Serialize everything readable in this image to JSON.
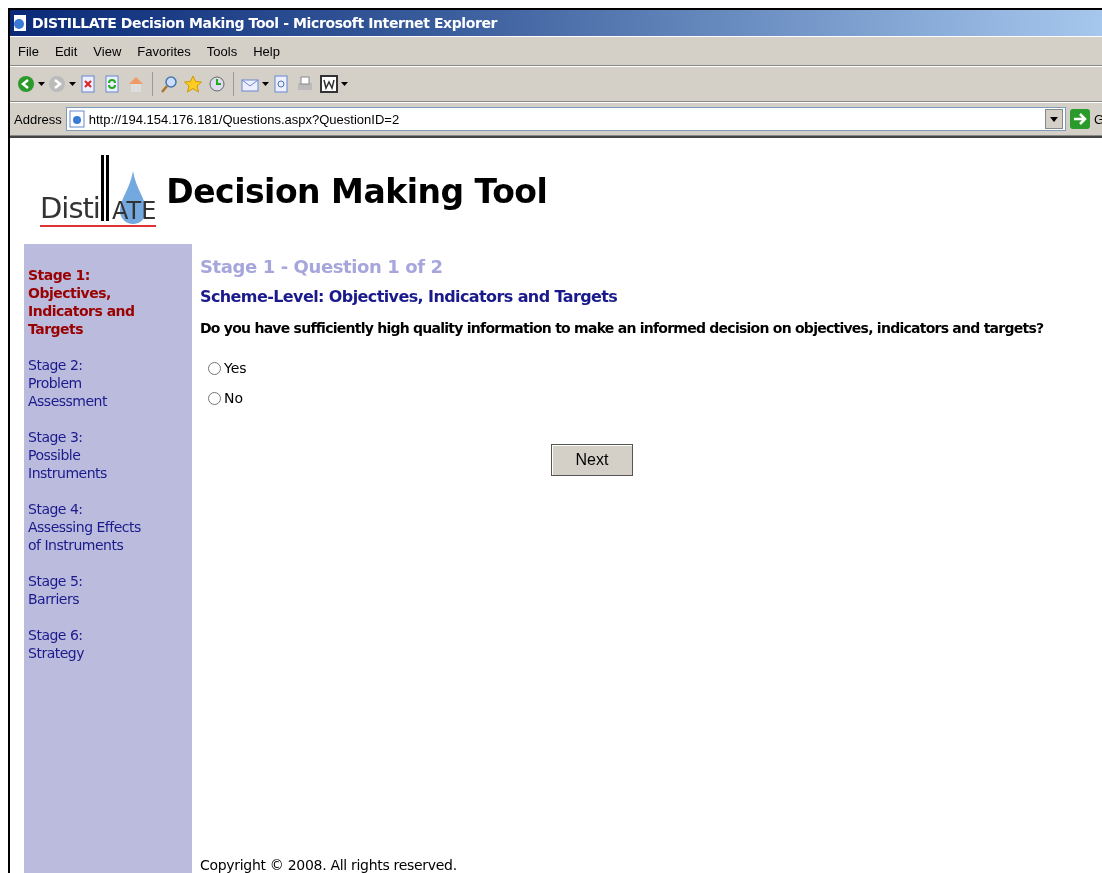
{
  "window": {
    "title": "DISTILLATE Decision Making Tool - Microsoft Internet Explorer"
  },
  "menu": [
    "File",
    "Edit",
    "View",
    "Favorites",
    "Tools",
    "Help"
  ],
  "address": {
    "label": "Address",
    "value": "http://194.154.176.181/Questions.aspx?QuestionID=2",
    "go": "G"
  },
  "header": {
    "logo": {
      "left": "Disti",
      "right": "ATE"
    },
    "title": "Decision Making Tool"
  },
  "sidebar": {
    "items": [
      {
        "stage": "Stage 1:",
        "name": "Objectives, Indicators and Targets",
        "selected": true
      },
      {
        "stage": "Stage 2:",
        "name": "Problem Assessment",
        "selected": false
      },
      {
        "stage": "Stage 3:",
        "name": "Possible Instruments",
        "selected": false
      },
      {
        "stage": "Stage 4:",
        "name": "Assessing Effects of Instruments",
        "selected": false
      },
      {
        "stage": "Stage 5:",
        "name": "Barriers",
        "selected": false
      },
      {
        "stage": "Stage 6:",
        "name": "Strategy",
        "selected": false
      }
    ]
  },
  "main": {
    "progress": "Stage 1 - Question 1 of 2",
    "section": "Scheme-Level: Objectives, Indicators and Targets",
    "question": "Do you have sufficiently high quality information to make an informed decision on objectives, indicators and targets?",
    "options": [
      {
        "label": "Yes",
        "checked": false
      },
      {
        "label": "No",
        "checked": false
      }
    ],
    "button": "Next",
    "footer": "Copyright © 2008. All rights reserved."
  }
}
